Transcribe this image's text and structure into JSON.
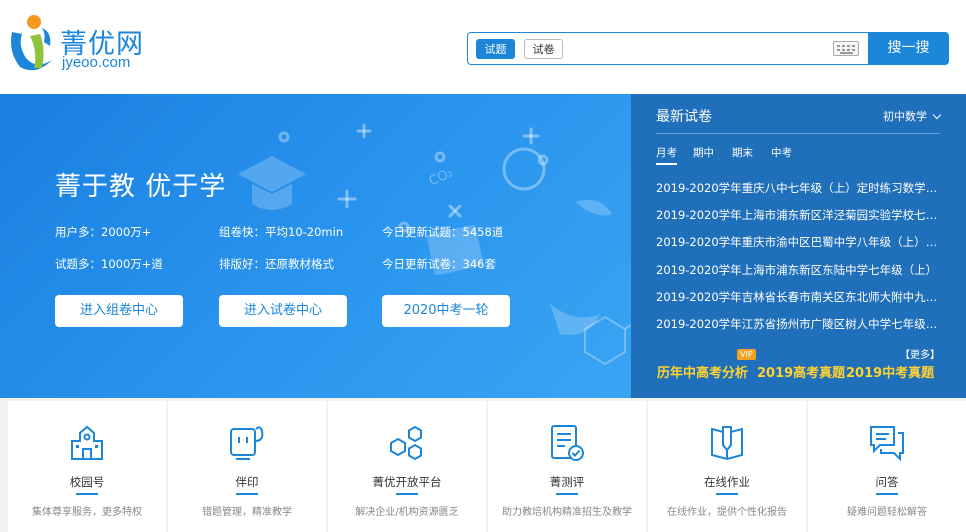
{
  "header": {
    "logo_cn": "菁优网",
    "logo_en": "jyeoo.com",
    "search": {
      "tab_active": "试题",
      "tab_inactive": "试卷",
      "placeholder": "",
      "button": "搜一搜"
    }
  },
  "banner": {
    "slogan": "菁于教 优于学",
    "stats": [
      "用户多：2000万+",
      "组卷快：平均10-20min",
      "今日更新试题：5458道",
      "试题多：1000万+道",
      "排版好：还原教材格式",
      "今日更新试卷：346套"
    ],
    "buttons": [
      "进入组卷中心",
      "进入试卷中心",
      "2020中考一轮"
    ],
    "deco_text": "CO₂"
  },
  "papers": {
    "title": "最新试卷",
    "grade": "初中数学",
    "tabs": [
      "月考",
      "期中",
      "期末",
      "中考"
    ],
    "items": [
      "2019-2020学年重庆八中七年级（上）定时练习数学试卷",
      "2019-2020学年上海市浦东新区洋泾菊园实验学校七年级",
      "2019-2020学年重庆市渝中区巴蜀中学八年级（上）第一",
      "2019-2020学年上海市浦东新区东陆中学七年级（上）",
      "2019-2020学年吉林省长春市南关区东北师大附中九年级",
      "2019-2020学年江苏省扬州市广陵区树人中学七年级（上"
    ],
    "more": "【更多】",
    "vip": "VIP",
    "hot_links": [
      "历年中高考分析",
      "2019高考真题",
      "2019中考真题"
    ]
  },
  "features": [
    {
      "name": "校园号",
      "desc": "集体尊享服务，更多特权",
      "icon": "school-icon"
    },
    {
      "name": "伴印",
      "desc": "错题管理，精准教学",
      "icon": "printer-icon"
    },
    {
      "name": "菁优开放平台",
      "desc": "解决企业/机构资源匮乏",
      "icon": "hexagon-icon"
    },
    {
      "name": "菁测评",
      "desc": "助力教培机构精准招生及教学",
      "icon": "clipboard-check-icon"
    },
    {
      "name": "在线作业",
      "desc": "在线作业，提供个性化报告",
      "icon": "book-pencil-icon"
    },
    {
      "name": "问答",
      "desc": "疑难问题轻松解答",
      "icon": "chat-icon"
    }
  ],
  "colors": {
    "brand": "#1c86d8",
    "panel": "#1f6fba",
    "hot": "#ffd230"
  }
}
